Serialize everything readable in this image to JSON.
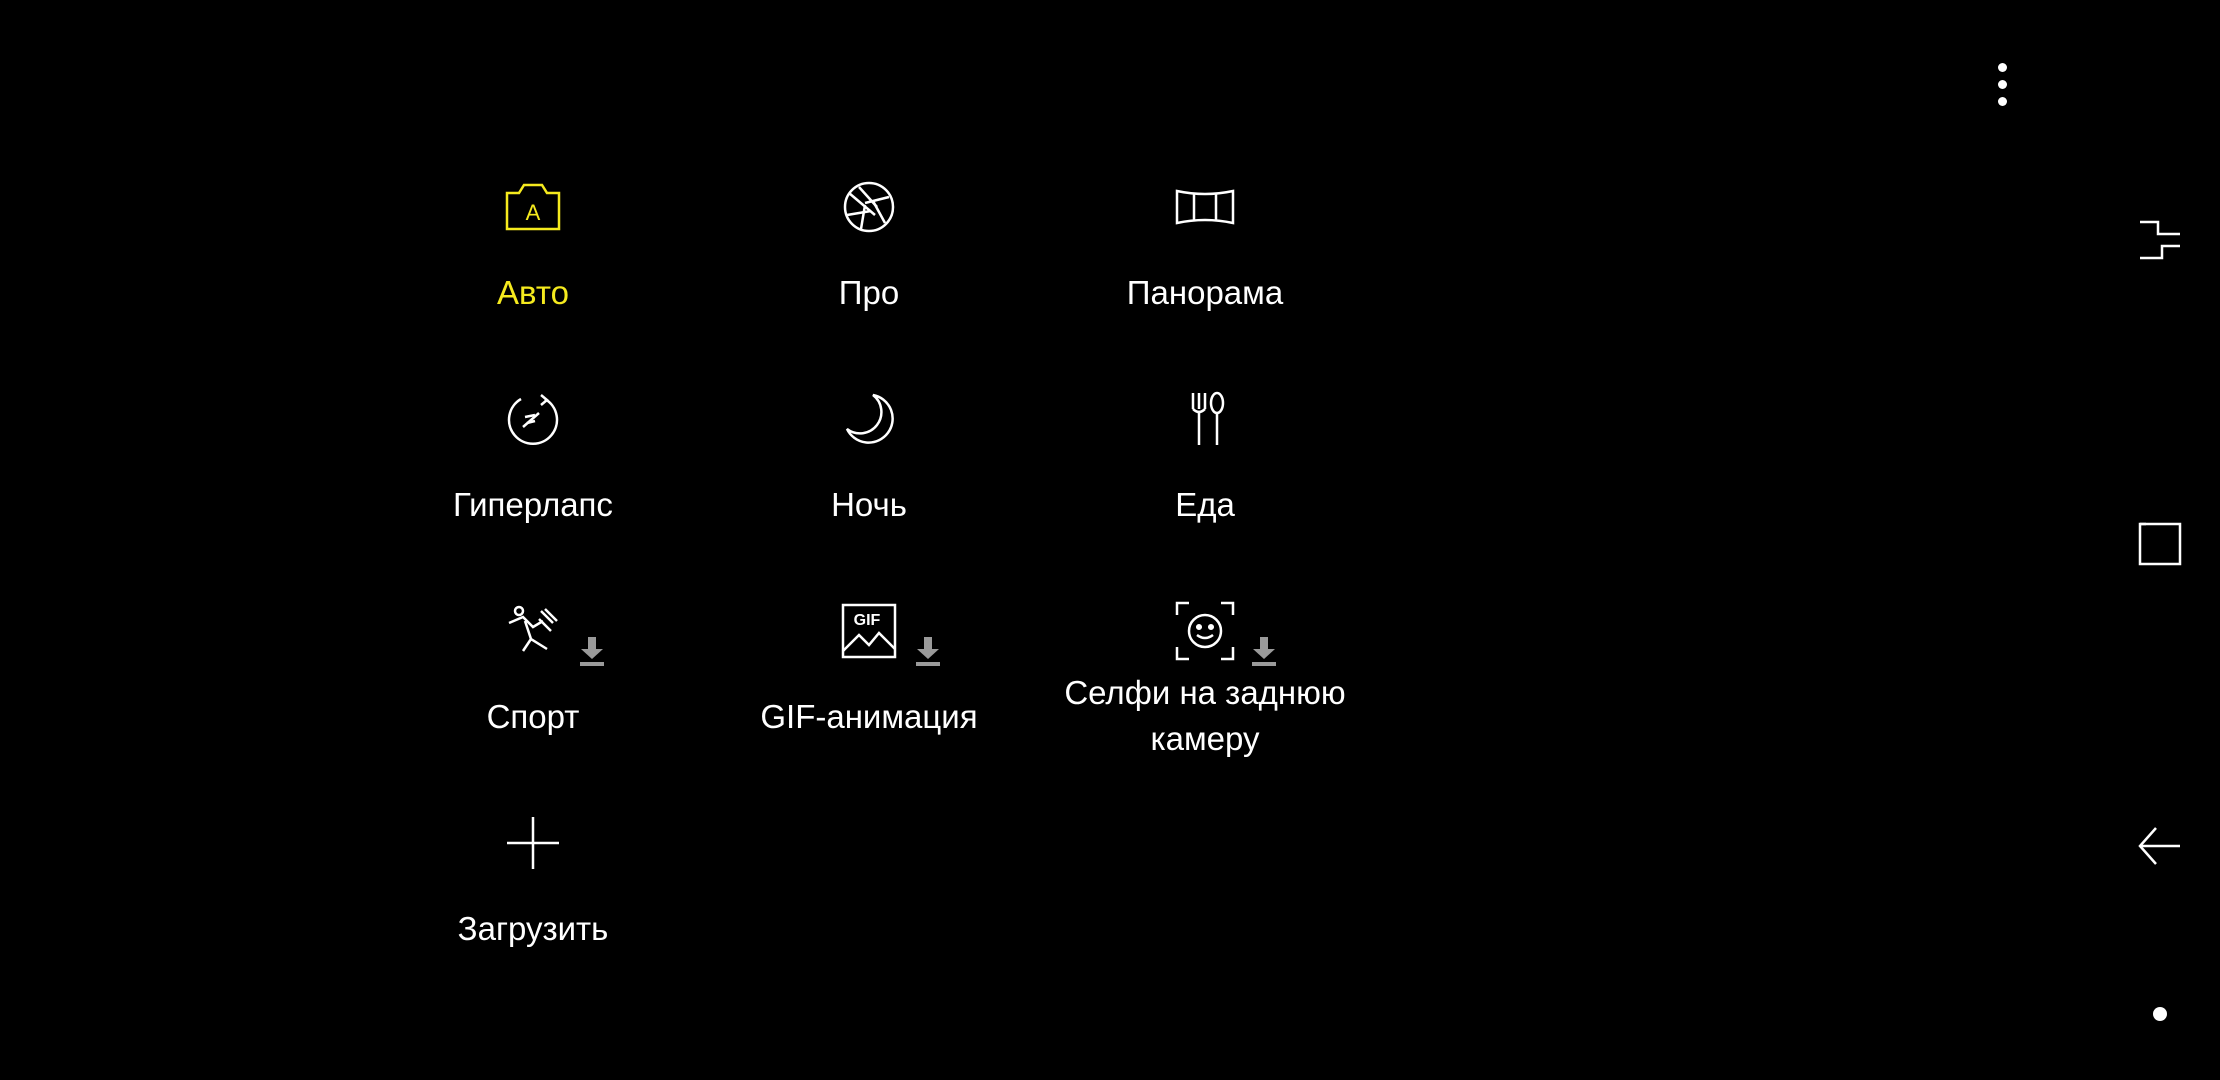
{
  "header": {
    "more_icon": "more-vertical-icon"
  },
  "modes": [
    {
      "id": "auto",
      "label": "Авто",
      "icon": "auto-camera-icon",
      "selected": true,
      "download": false
    },
    {
      "id": "pro",
      "label": "Про",
      "icon": "aperture-icon",
      "selected": false,
      "download": false
    },
    {
      "id": "panorama",
      "label": "Панорама",
      "icon": "panorama-icon",
      "selected": false,
      "download": false
    },
    {
      "id": "hyperlapse",
      "label": "Гиперлапс",
      "icon": "hyperlapse-icon",
      "selected": false,
      "download": false
    },
    {
      "id": "night",
      "label": "Ночь",
      "icon": "moon-icon",
      "selected": false,
      "download": false
    },
    {
      "id": "food",
      "label": "Еда",
      "icon": "fork-spoon-icon",
      "selected": false,
      "download": false
    },
    {
      "id": "sport",
      "label": "Спорт",
      "icon": "sport-icon",
      "selected": false,
      "download": true
    },
    {
      "id": "gif",
      "label": "GIF-анимация",
      "icon": "gif-icon",
      "icon_text": "GIF",
      "selected": false,
      "download": true
    },
    {
      "id": "rear-selfie",
      "label": "Селфи на заднюю камеру",
      "icon": "face-scan-icon",
      "selected": false,
      "download": true
    },
    {
      "id": "download-more",
      "label": "Загрузить",
      "icon": "plus-icon",
      "selected": false,
      "download": false
    }
  ],
  "navbar": {
    "recents_icon": "recents-icon",
    "home_icon": "home-icon",
    "back_icon": "back-icon",
    "status_icon": "dot-icon"
  },
  "colors": {
    "accent": "#f5ea1e",
    "background": "#000000",
    "text": "#ffffff",
    "download_badge": "#9a9a9a"
  }
}
